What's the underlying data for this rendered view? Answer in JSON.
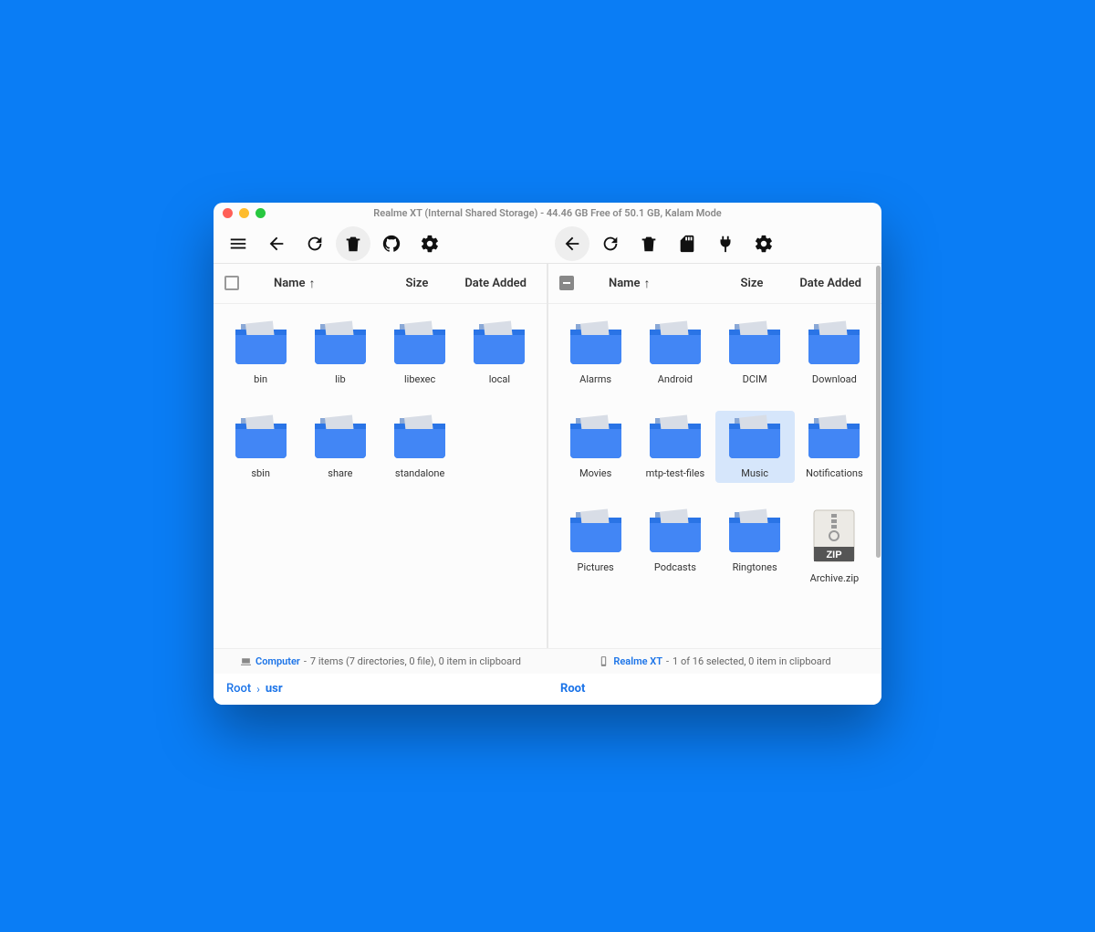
{
  "window": {
    "title": "Realme XT (Internal Shared Storage) - 44.46 GB Free of 50.1 GB, Kalam Mode"
  },
  "columns": {
    "name": "Name",
    "size": "Size",
    "date": "Date Added"
  },
  "left": {
    "device": "Computer",
    "status_sep": " - ",
    "status_text": "7 items (7 directories, 0 file), 0 item in clipboard",
    "crumbs": [
      "Root",
      "usr"
    ],
    "items": [
      {
        "name": "bin",
        "type": "folder"
      },
      {
        "name": "lib",
        "type": "folder"
      },
      {
        "name": "libexec",
        "type": "folder"
      },
      {
        "name": "local",
        "type": "folder"
      },
      {
        "name": "sbin",
        "type": "folder"
      },
      {
        "name": "share",
        "type": "folder"
      },
      {
        "name": "standalone",
        "type": "folder"
      }
    ]
  },
  "right": {
    "device": "Realme XT",
    "status_sep": " - ",
    "status_text": "1 of 16 selected, 0 item in clipboard",
    "crumbs": [
      "Root"
    ],
    "selected_index": 6,
    "items": [
      {
        "name": "Alarms",
        "type": "folder"
      },
      {
        "name": "Android",
        "type": "folder"
      },
      {
        "name": "DCIM",
        "type": "folder"
      },
      {
        "name": "Download",
        "type": "folder"
      },
      {
        "name": "Movies",
        "type": "folder"
      },
      {
        "name": "mtp-test-files",
        "type": "folder"
      },
      {
        "name": "Music",
        "type": "folder"
      },
      {
        "name": "Notifications",
        "type": "folder"
      },
      {
        "name": "Pictures",
        "type": "folder"
      },
      {
        "name": "Podcasts",
        "type": "folder"
      },
      {
        "name": "Ringtones",
        "type": "folder"
      },
      {
        "name": "Archive.zip",
        "type": "zip"
      }
    ]
  }
}
